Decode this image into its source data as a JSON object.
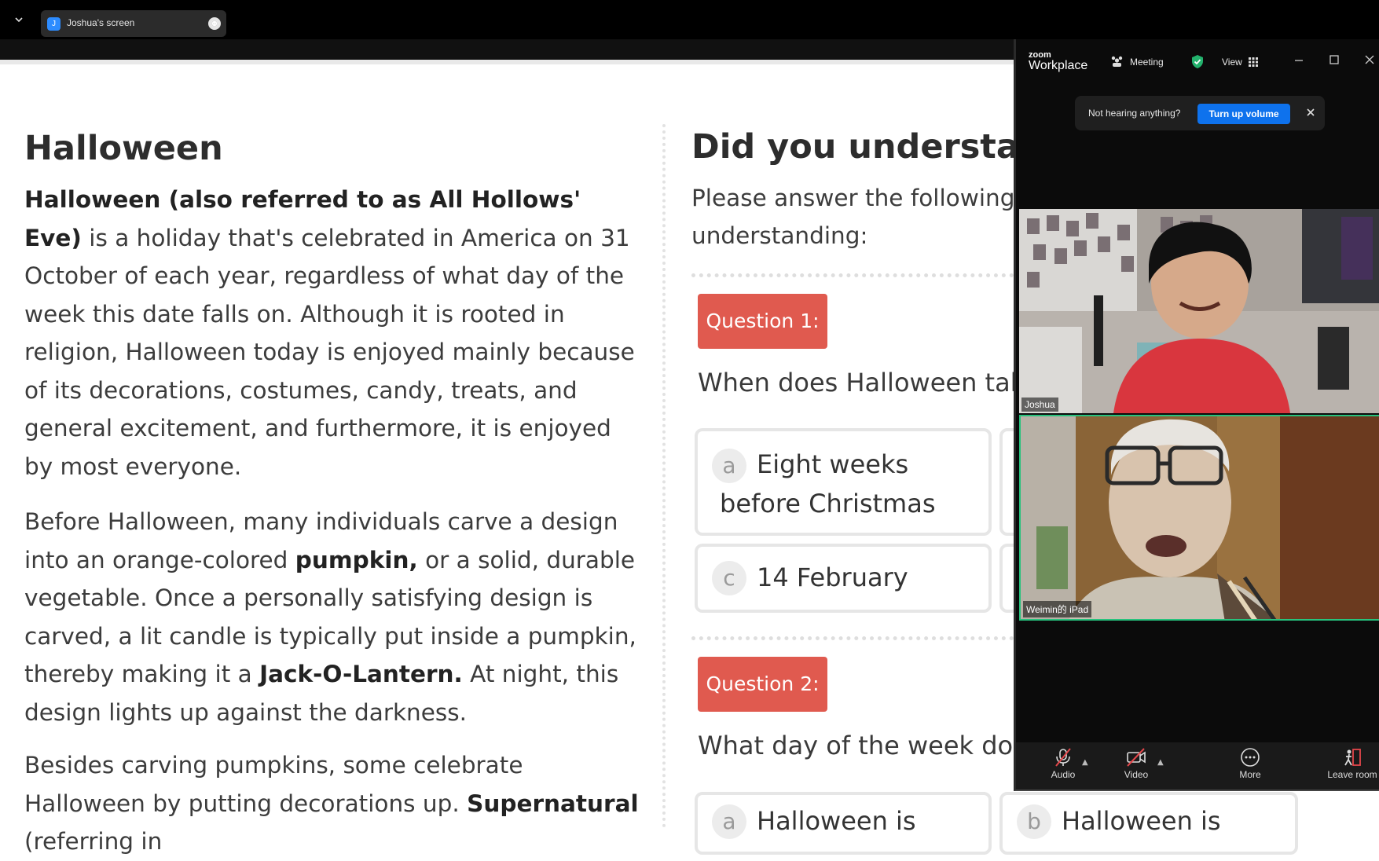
{
  "share_bar": {
    "presenter_initial": "J",
    "tab_label": "Joshua's screen"
  },
  "lesson": {
    "title": "Halloween",
    "p1_bold": "Halloween (also referred to as All Hollows' Eve)",
    "p1_rest": " is a holiday that's celebrated in America on 31 October of each year, regardless of what day of the week this date falls on. Although it is rooted in religion, Halloween today is enjoyed mainly because of its decorations, costumes, candy, treats, and general excitement, and furthermore, it is enjoyed by most everyone.",
    "p2_a": "Before Halloween, many individuals carve a design into an orange-colored ",
    "p2_b": "pumpkin,",
    "p2_c": " or a solid, durable vegetable. Once a personally satisfying design is carved, a lit candle is typically put inside a pumpkin, thereby making it a ",
    "p2_d": "Jack-O-Lantern.",
    "p2_e": " At night, this design lights up against the darkness.",
    "p3_a": "Besides carving pumpkins, some celebrate Halloween by putting decorations up. ",
    "p3_b": "Supernatural",
    "p3_c": " (referring in"
  },
  "quiz": {
    "title": "Did you understand t",
    "intro": "Please answer the following understanding:",
    "q1_badge": "Question 1:",
    "q1_text": "When does Halloween tal",
    "q1_opt_a_letter": "a",
    "q1_opt_a_line1": "Eight weeks",
    "q1_opt_a_line2": "before Christmas",
    "q1_opt_c_letter": "c",
    "q1_opt_c": "14 February",
    "q2_badge": "Question 2:",
    "q2_text": "What day of the week do",
    "q2_opt_a_letter": "a",
    "q2_opt_a": "Halloween is",
    "q2_opt_b_letter": "b",
    "q2_opt_b": "Halloween is"
  },
  "zoom": {
    "logo_small": "zoom",
    "logo_large": "Workplace",
    "meeting_label": "Meeting",
    "view_label": "View",
    "notice_text": "Not hearing anything?",
    "notice_button": "Turn up volume",
    "participant1": "Joshua",
    "participant2": "Weimin的 iPad",
    "audio_label": "Audio",
    "video_label": "Video",
    "more_label": "More",
    "leave_label": "Leave room",
    "colors": {
      "accent_blue": "#0e72ed",
      "active_speaker": "#27c27d",
      "shield_green": "#23b26d",
      "mute_red": "#e5474b"
    }
  }
}
